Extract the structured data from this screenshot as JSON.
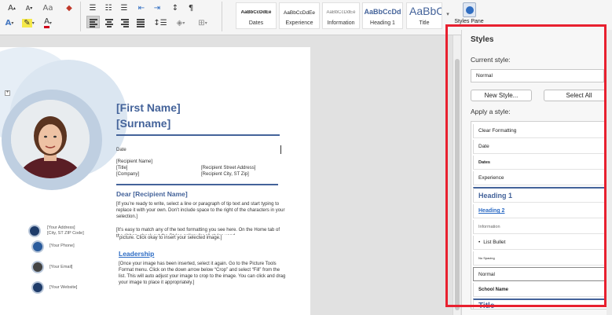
{
  "colors": {
    "accent": "#44639a",
    "link": "#2c6bc4",
    "highlight_box": "#e8202f"
  },
  "ribbon": {
    "font_grow": "A",
    "font_shrink": "A",
    "text_effects_glyph": "A",
    "highlight_glyph": "✎",
    "font_color_glyph": "A",
    "format_painter_glyph": "◆",
    "paragraph_mark": "¶",
    "styles_gallery": [
      {
        "preview": "AaBbCcDdEe",
        "name": "Dates"
      },
      {
        "preview": "AaBbCcDdEe",
        "name": "Experience"
      },
      {
        "preview": "AaBbCcDdEe",
        "name": "Information"
      },
      {
        "preview": "AaBbCcDd",
        "name": "Heading 1"
      },
      {
        "preview": "AaBbC",
        "name": "Title"
      }
    ],
    "styles_pane_label": "Styles Pane"
  },
  "document": {
    "first_name": "[First Name]",
    "surname": "[Surname]",
    "date": "Date",
    "recipient_name": "[Recipient Name]",
    "title": "[Title]",
    "company": "[Company]",
    "recipient_street": "[Recipient Street Address]",
    "recipient_city": "[Recipient City, ST Zip]",
    "dear": "Dear [Recipient Name]",
    "para1": "[If you’re ready to write, select a line or paragraph of tip text and start typing to replace it with your own. Don’t include space to the right of the characters in your selection.]",
    "para2": "[It’s easy to match any of the text formatting you see here. On the Home tab of the ribbon, check out the Styles gallery for all styles used",
    "picture_tip": "picture.  Click okay to insert your selected image.]",
    "leadership": "Leadership",
    "para3": "[Once your image has been inserted, select it again.  Go to the Picture Tools Format menu. Click on the down arrow below “Crop” and select “Fill” from the list.  This will auto adjust your image to crop to the image. You can click and drag your image to place it appropriately.]",
    "contact": {
      "address_line1": "[Your Address]",
      "address_line2": "[City, ST ZIP Code]",
      "phone": "[Your Phone]",
      "email": "[Your Email]",
      "website": "[Your Website]"
    }
  },
  "styles_pane": {
    "title": "Styles",
    "current_style_label": "Current style:",
    "current_style_value": "Normal",
    "new_style_button": "New Style...",
    "select_all_button": "Select All",
    "apply_label": "Apply a style:",
    "styles": [
      "Clear Formatting",
      "Date",
      "Dates",
      "Experience",
      "Heading 1",
      "Heading 2",
      "Information",
      "List Bullet",
      "No Spacing",
      "Normal",
      "School Name",
      "Title"
    ],
    "bullet_glyph": "•"
  }
}
